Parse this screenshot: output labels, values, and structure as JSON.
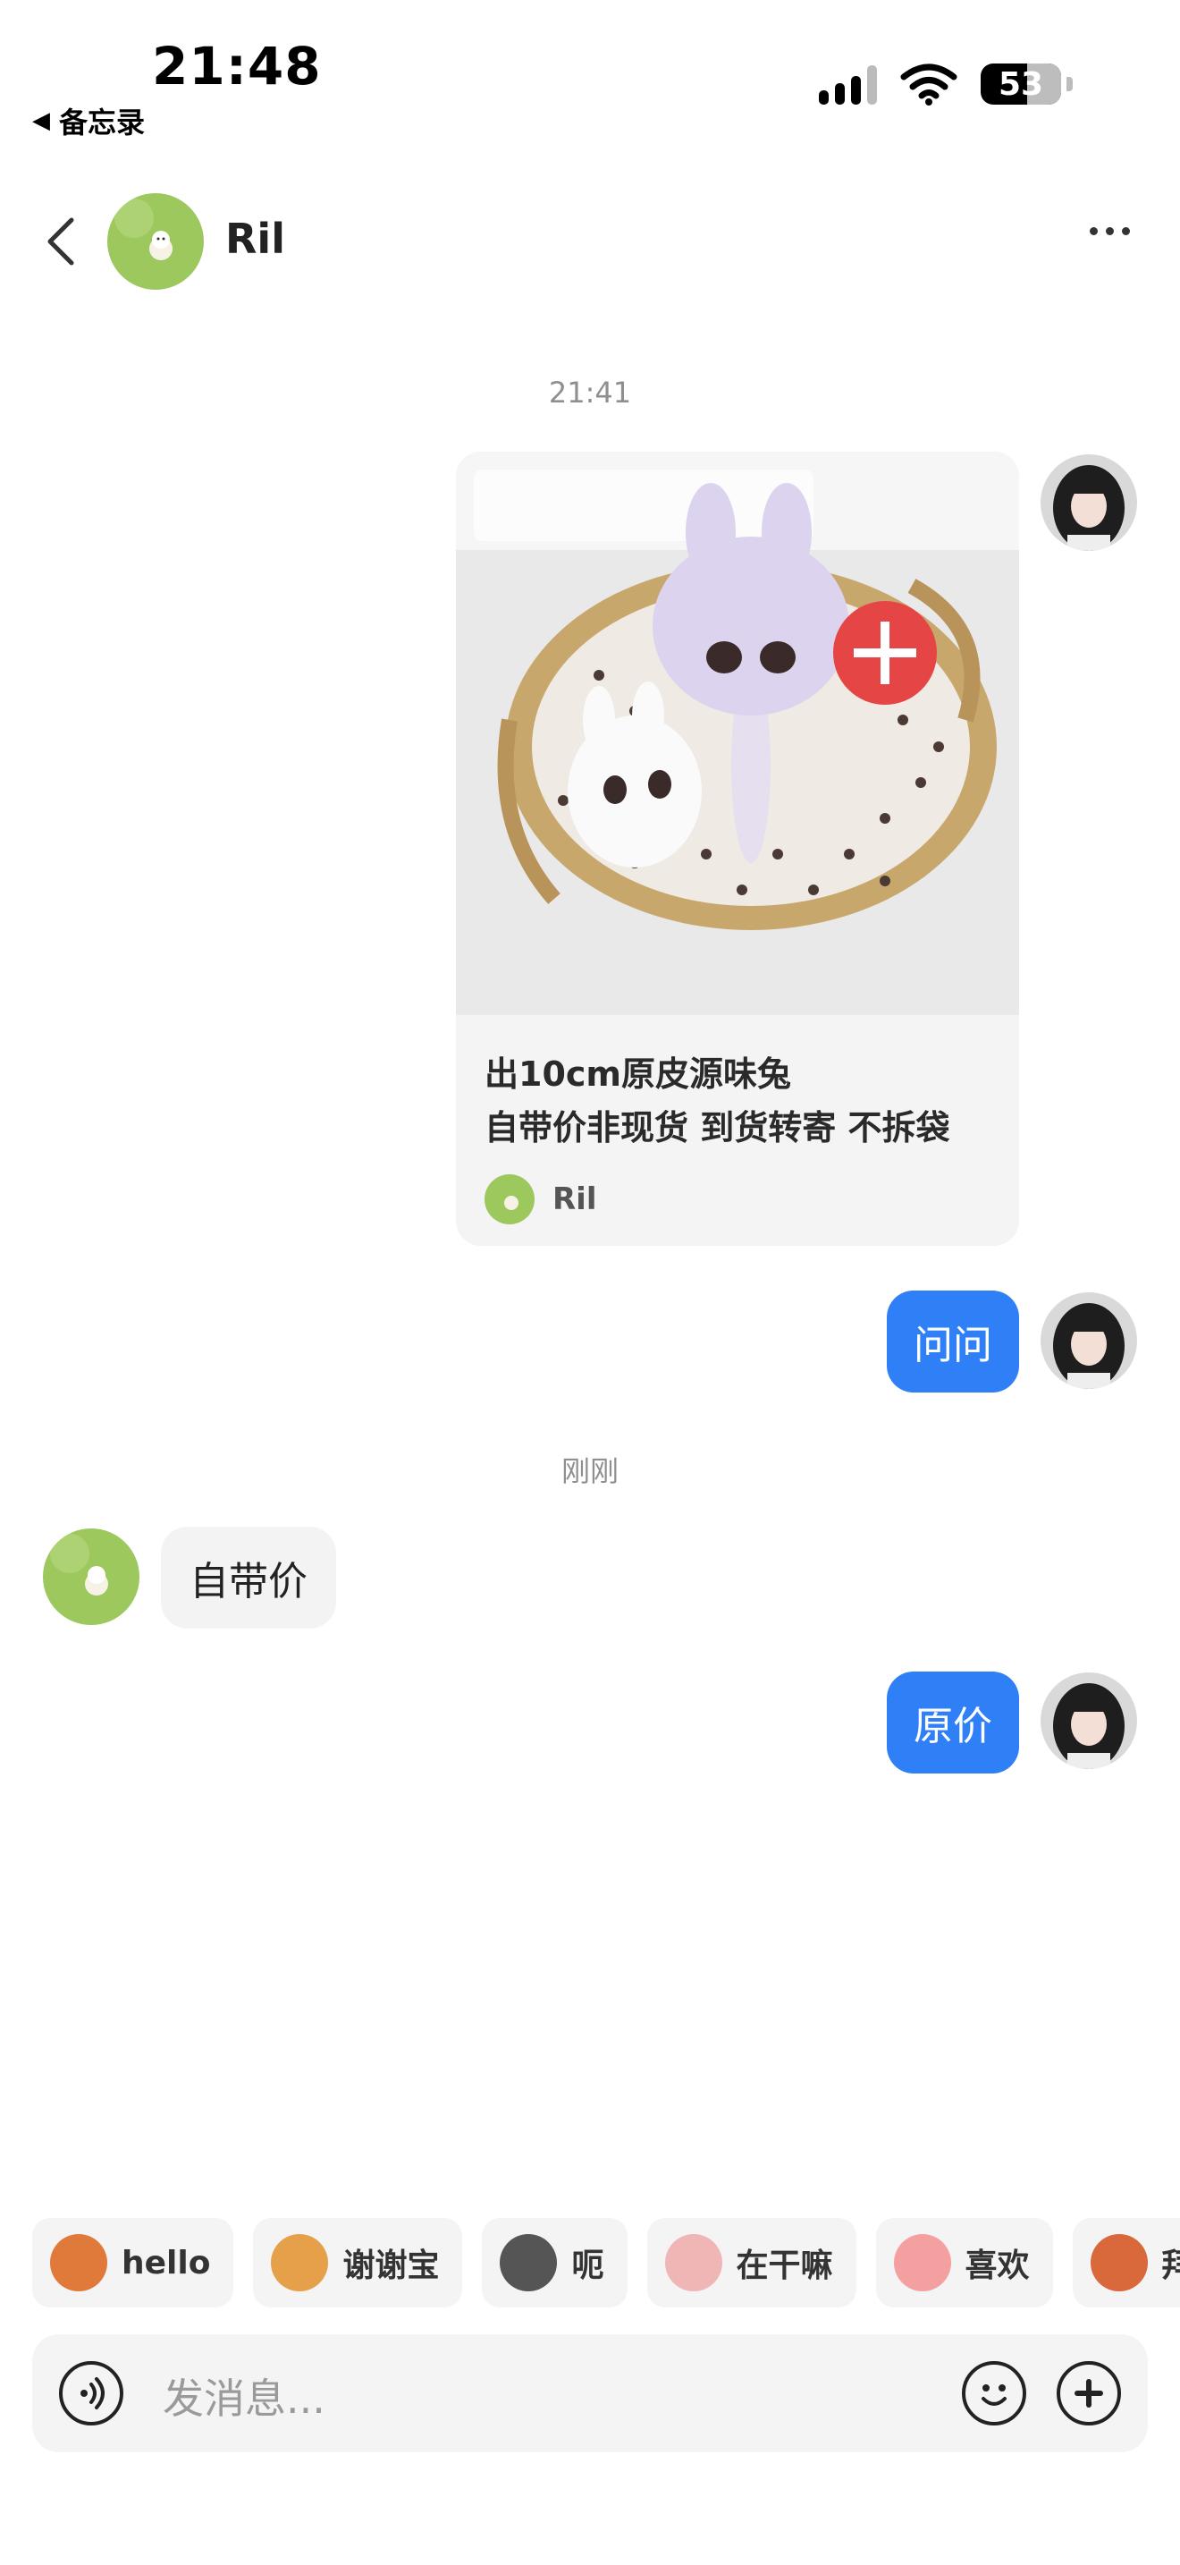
{
  "status_bar": {
    "time": "21:48",
    "back_app": "备忘录",
    "battery_level": "53"
  },
  "header": {
    "contact_name": "Ril"
  },
  "messages": {
    "timestamp_1": "21:41",
    "card": {
      "line1": "出10cm原皮源味兔",
      "line2": "自带价非现货 到货转寄 不拆袋",
      "author": "Ril"
    },
    "me_1": "问问",
    "timestamp_2": "刚刚",
    "peer_1": "自带价",
    "me_2": "原价"
  },
  "quick_replies": [
    {
      "label": "hello",
      "icon": "monkey-emoji-icon",
      "color": "#e07a3a"
    },
    {
      "label": "谢谢宝",
      "icon": "girl-flower-emoji-icon",
      "color": "#e6a04a"
    },
    {
      "label": "呃",
      "icon": "cat-emoji-icon",
      "color": "#555555"
    },
    {
      "label": "在干嘛",
      "icon": "peek-emoji-icon",
      "color": "#f0b6b6"
    },
    {
      "label": "喜欢",
      "icon": "love-emoji-icon",
      "color": "#f4a0a0"
    },
    {
      "label": "拜",
      "icon": "monkey-cover-emoji-icon",
      "color": "#d9683a"
    }
  ],
  "input": {
    "placeholder": "发消息..."
  },
  "colors": {
    "my_bubble": "#2f7ff7",
    "peer_bubble": "#f3f3f3"
  }
}
